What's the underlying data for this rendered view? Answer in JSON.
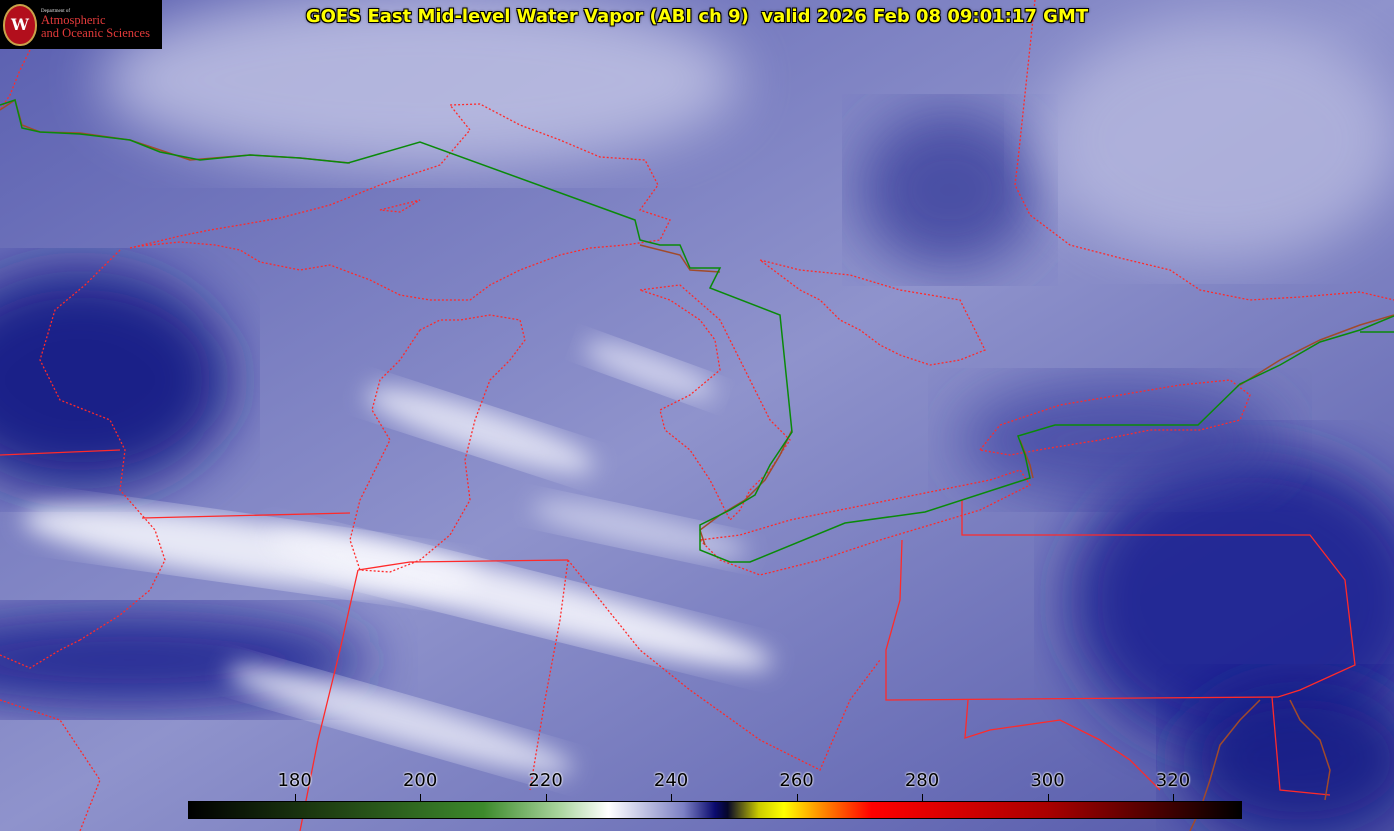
{
  "title": "GOES East Mid-level Water Vapor (ABI ch 9)  valid 2026 Feb 08 09:01:17 GMT",
  "logo": {
    "department_line": "Department of",
    "line1": "Atmospheric",
    "line2": "and Oceanic Sciences",
    "seal_letter": "W"
  },
  "colorbar": {
    "ticks": [
      180,
      200,
      220,
      240,
      260,
      280,
      300,
      320
    ],
    "range": [
      163,
      331
    ],
    "stops": [
      {
        "value": 163,
        "color": "#000000"
      },
      {
        "value": 185,
        "color": "#1f3f12"
      },
      {
        "value": 210,
        "color": "#3d8a2c"
      },
      {
        "value": 222,
        "color": "#a8d49c"
      },
      {
        "value": 230,
        "color": "#ffffff"
      },
      {
        "value": 242,
        "color": "#7c80c4"
      },
      {
        "value": 247,
        "color": "#0a0a6e"
      },
      {
        "value": 249,
        "color": "#05052a"
      },
      {
        "value": 254,
        "color": "#cccc00"
      },
      {
        "value": 258,
        "color": "#ffff00"
      },
      {
        "value": 264,
        "color": "#ff8c00"
      },
      {
        "value": 272,
        "color": "#ff0000"
      },
      {
        "value": 300,
        "color": "#aa0000"
      },
      {
        "value": 331,
        "color": "#000000"
      }
    ]
  },
  "colors": {
    "background": "#6e73b8",
    "state_borders": "#ff2a2a",
    "country_border": "#0a8a0a",
    "coastline": "#a14a2a",
    "title": "#ffff00"
  }
}
